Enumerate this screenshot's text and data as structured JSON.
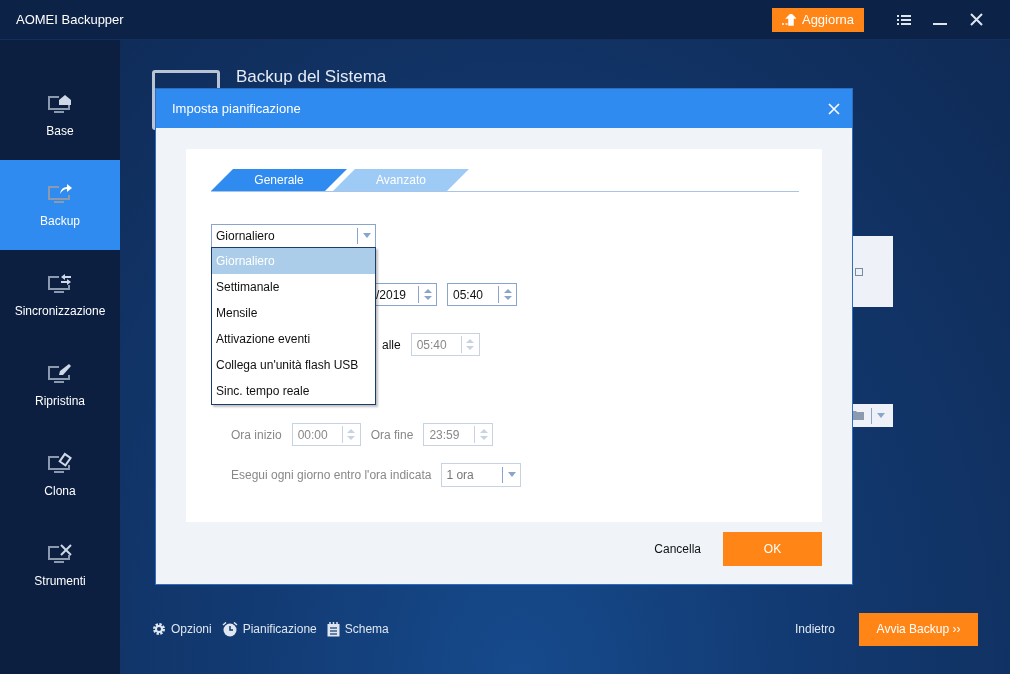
{
  "app": {
    "title": "AOMEI Backupper",
    "upgrade_button": "Aggiorna"
  },
  "sidebar": {
    "items": [
      {
        "label": "Base",
        "kind": "home",
        "selected": false
      },
      {
        "label": "Backup",
        "kind": "share",
        "selected": true
      },
      {
        "label": "Sincronizzazione",
        "kind": "sync",
        "selected": false
      },
      {
        "label": "Ripristina",
        "kind": "restore",
        "selected": false
      },
      {
        "label": "Clona",
        "kind": "clone",
        "selected": false
      },
      {
        "label": "Strumenti",
        "kind": "tools",
        "selected": false
      }
    ]
  },
  "page": {
    "title": "Backup del Sistema"
  },
  "dialog": {
    "title": "Imposta pianificazione",
    "tabs": [
      {
        "label": "Generale",
        "selected": true
      },
      {
        "label": "Avanzato",
        "selected": false
      }
    ],
    "frequency": {
      "value": "Giornaliero",
      "expanded": true,
      "options": [
        {
          "label": "Giornaliero",
          "selected": true
        },
        {
          "label": "Settimanale",
          "selected": false
        },
        {
          "label": "Mensile",
          "selected": false
        },
        {
          "label": "Attivazione eventi",
          "selected": false
        },
        {
          "label": "Collega un'unità flash USB",
          "selected": false
        },
        {
          "label": "Sinc. tempo reale",
          "selected": false
        }
      ]
    },
    "start_date": {
      "value": "/2019",
      "disabled": false
    },
    "start_time": {
      "value": "05:40",
      "disabled": false
    },
    "repeat": {
      "label": "alle",
      "value": "05:40",
      "disabled": true
    },
    "range": {
      "start_label": "Ora inizio",
      "start_value": "00:00",
      "end_label": "Ora fine",
      "end_value": "23:59",
      "disabled": true
    },
    "interval": {
      "label": "Esegui ogni giorno entro l'ora indicata",
      "value": "1 ora",
      "disabled": true
    },
    "cancel_button": "Cancella",
    "ok_button": "OK"
  },
  "footer": {
    "tools": [
      {
        "label": "Opzioni",
        "kind": "gear"
      },
      {
        "label": "Pianificazione",
        "kind": "clock"
      },
      {
        "label": "Schema",
        "kind": "list"
      }
    ],
    "back_button": "Indietro",
    "start_button": "Avvia Backup ››"
  }
}
